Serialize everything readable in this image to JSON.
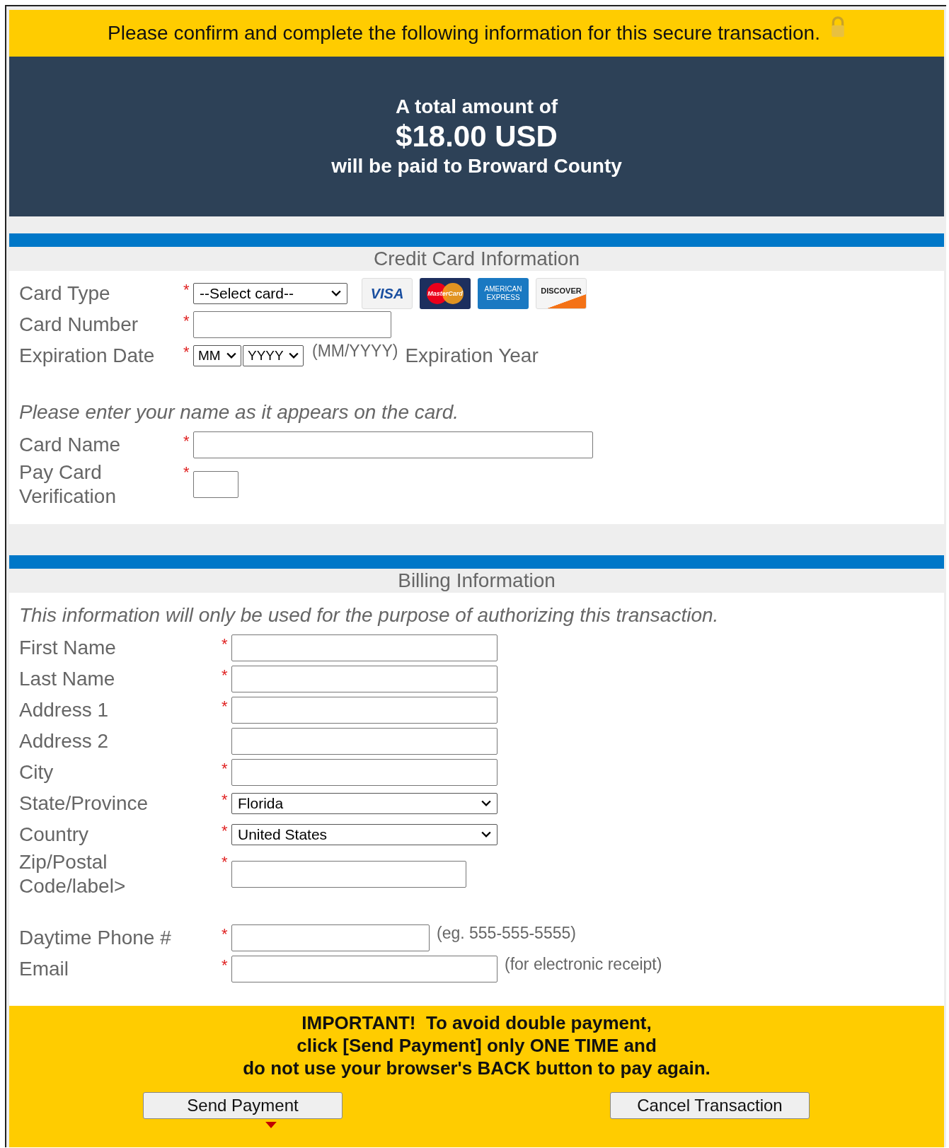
{
  "notice": "Please confirm and complete the following information for this secure transaction.",
  "total": {
    "intro": "A total amount of",
    "amount": "$18.00 USD",
    "payee": "will be paid to Broward County"
  },
  "card_section": {
    "title": "Credit Card Information",
    "card_logos": [
      {
        "kind": "visa",
        "label": "VISA"
      },
      {
        "kind": "mastercard",
        "label": "MasterCard"
      },
      {
        "kind": "amex",
        "label": "AMERICAN EXPRESS"
      },
      {
        "kind": "discover",
        "label": "DISCOVER"
      }
    ],
    "fields": [
      {
        "kind": "select",
        "label": "Card Type",
        "mark": "*",
        "value": "--Select card--"
      },
      {
        "kind": "input",
        "label": "Card Number",
        "mark": "*"
      },
      {
        "kind": "date",
        "label": "Expiration Date",
        "mark": "*",
        "month": "MM",
        "year": "YYYY",
        "hint": "(MM/YYYY)",
        "after": "Expiration Year"
      },
      {
        "kind": "note",
        "text": "Please enter your name as it appears on the card."
      },
      {
        "kind": "input",
        "label": "Card Name",
        "mark": "*"
      },
      {
        "kind": "input",
        "label": "Pay Card Verification",
        "mark": "*"
      }
    ]
  },
  "billing_section": {
    "title": "Billing Information",
    "fields": [
      {
        "kind": "note",
        "text": "This information will only be used for the purpose of authorizing this transaction."
      },
      {
        "kind": "input",
        "label": "First Name",
        "mark": "*"
      },
      {
        "kind": "input",
        "label": "Last Name",
        "mark": "*"
      },
      {
        "kind": "input",
        "label": "Address 1",
        "mark": "*"
      },
      {
        "kind": "input",
        "label": "Address 2"
      },
      {
        "kind": "input",
        "label": "City",
        "mark": "*"
      },
      {
        "kind": "select",
        "label": "State/Province",
        "mark": "*",
        "value": "Florida"
      },
      {
        "kind": "select",
        "label": "Country",
        "mark": "*",
        "value": "United States"
      },
      {
        "kind": "input",
        "label": "Zip/Postal Code/label>",
        "mark": "*"
      },
      {
        "kind": "input",
        "label": "Daytime Phone #",
        "mark": "*",
        "hint": "(eg. 555-555-5555)"
      },
      {
        "kind": "input",
        "label": "Email",
        "mark": "*",
        "hint": "(for electronic receipt)"
      }
    ]
  },
  "warning": [
    "IMPORTANT!  To avoid double payment,",
    "click [Send Payment] only ONE TIME and",
    "do not use your browser's BACK button to pay again."
  ],
  "buttons": [
    "Send Payment",
    "Cancel Transaction"
  ]
}
